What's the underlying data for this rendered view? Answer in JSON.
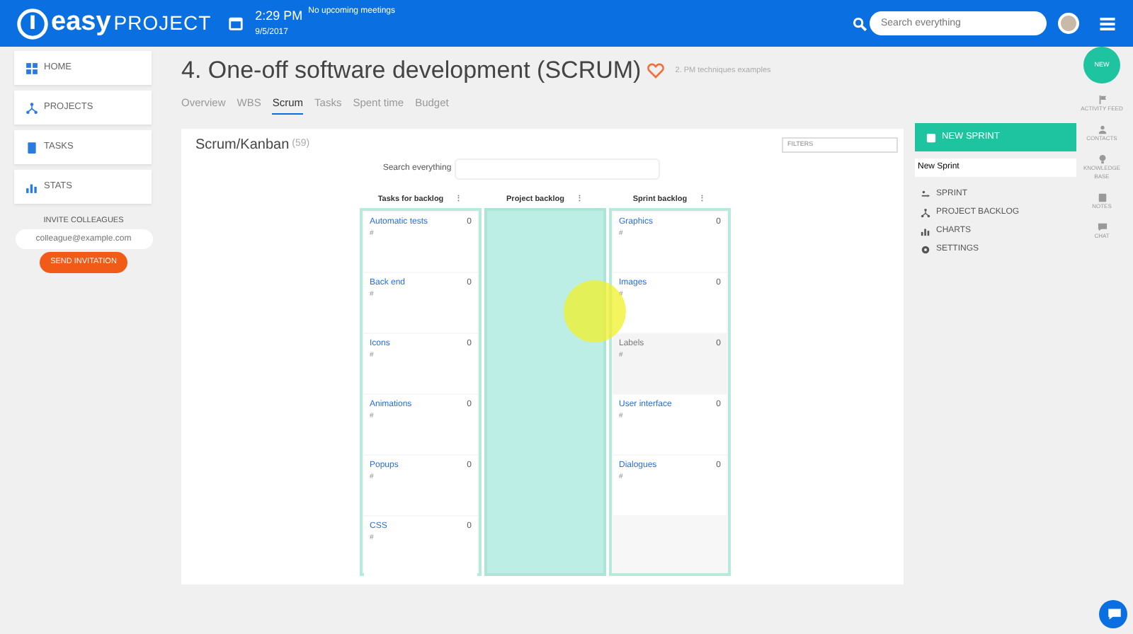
{
  "header": {
    "logo_bold": "easy",
    "logo_light": "PROJECT",
    "time": "2:29 PM",
    "date": "9/5/2017",
    "meetings": "No upcoming meetings",
    "search": {
      "placeholder": "Search everything"
    }
  },
  "sidebar": {
    "items": [
      {
        "label": "HOME",
        "kind": "home"
      },
      {
        "label": "PROJECTS",
        "kind": "projects"
      },
      {
        "label": "TASKS",
        "kind": "tasks"
      },
      {
        "label": "STATS",
        "kind": "stats"
      }
    ],
    "invite": {
      "title": "INVITE COLLEAGUES",
      "placeholder": "colleague@example.com",
      "button": "SEND INVITATION"
    }
  },
  "project": {
    "title": "4. One-off software development (SCRUM)",
    "parent": "2. PM techniques examples",
    "tabs": [
      {
        "label": "Overview",
        "selected": false
      },
      {
        "label": "WBS",
        "selected": false
      },
      {
        "label": "Scrum",
        "selected": true
      },
      {
        "label": "Tasks",
        "selected": false
      },
      {
        "label": "Spent time",
        "selected": false
      },
      {
        "label": "Budget",
        "selected": false
      }
    ]
  },
  "board": {
    "title": "Scrum/Kanban",
    "count": "(59)",
    "filter": "FILTERS",
    "search_label": "Search everything",
    "columns": [
      {
        "title": "Tasks for backlog",
        "menu": "⋮",
        "highlighted": false,
        "cards": [
          {
            "name": "Automatic tests",
            "count": "0",
            "ref": "#",
            "dragging": false
          },
          {
            "name": "Back end",
            "count": "0",
            "ref": "#",
            "dragging": false
          },
          {
            "name": "Icons",
            "count": "0",
            "ref": "#",
            "dragging": false
          },
          {
            "name": "Animations",
            "count": "0",
            "ref": "#",
            "dragging": false
          },
          {
            "name": "Popups",
            "count": "0",
            "ref": "#",
            "dragging": false
          },
          {
            "name": "CSS",
            "count": "0",
            "ref": "#",
            "dragging": false
          }
        ]
      },
      {
        "title": "Project backlog",
        "menu": "⋮",
        "highlighted": true
      },
      {
        "title": "Sprint backlog",
        "menu": "⋮",
        "highlighted": false,
        "cards": [
          {
            "name": "Graphics",
            "count": "0",
            "ref": "#",
            "dragging": false
          },
          {
            "name": "Images",
            "count": "0",
            "ref": "#",
            "dragging": false
          },
          {
            "name": "Labels",
            "count": "0",
            "ref": "#",
            "dragging": true
          },
          {
            "name": "User interface",
            "count": "0",
            "ref": "#",
            "dragging": false
          },
          {
            "name": "Dialogues",
            "count": "0",
            "ref": "#",
            "dragging": false
          }
        ]
      }
    ]
  },
  "sprint_panel": {
    "button": "NEW SPRINT",
    "select": "New Sprint",
    "items": [
      {
        "label": "SPRINT",
        "kind": "sprint"
      },
      {
        "label": "PROJECT BACKLOG",
        "kind": "backlog"
      },
      {
        "label": "CHARTS",
        "kind": "charts"
      },
      {
        "label": "SETTINGS",
        "kind": "settings"
      }
    ]
  },
  "rail": {
    "new": "NEW",
    "items": [
      {
        "label": "ACTIVITY FEED",
        "kind": "flag"
      },
      {
        "label": "CONTACTS",
        "kind": "person"
      },
      {
        "label": "KNOWLEDGE BASE",
        "kind": "bulb"
      },
      {
        "label": "NOTES",
        "kind": "note"
      },
      {
        "label": "CHAT",
        "kind": "chat"
      }
    ]
  }
}
